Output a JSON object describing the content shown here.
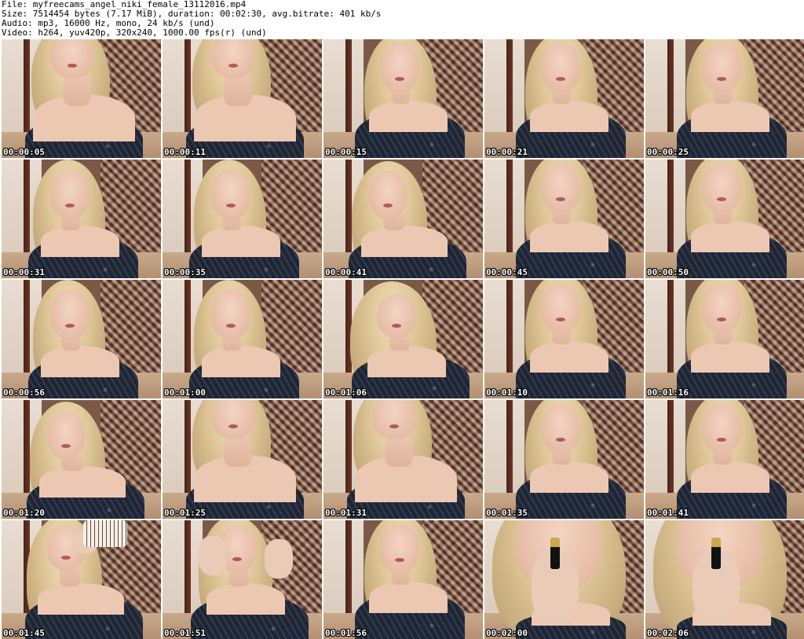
{
  "header": {
    "file_line": "File: myfreecams_angel_niki_female_13112016.mp4",
    "size_line": "Size: 7514454 bytes (7.17 MiB), duration: 00:02:30, avg.bitrate: 401 kb/s",
    "audio_line": "Audio: mp3, 16000 Hz, mono, 24 kb/s (und)",
    "video_line": "Video: h264, yuv420p, 320x240, 1000.00 fps(r) (und)"
  },
  "thumbnails": [
    {
      "timestamp": "00:00:05",
      "pose": "head-tilt-up"
    },
    {
      "timestamp": "00:00:11",
      "pose": "head-tilt-up"
    },
    {
      "timestamp": "00:00:15",
      "pose": "front"
    },
    {
      "timestamp": "00:00:21",
      "pose": "front"
    },
    {
      "timestamp": "00:00:25",
      "pose": "front"
    },
    {
      "timestamp": "00:00:31",
      "pose": "front-left"
    },
    {
      "timestamp": "00:00:35",
      "pose": "front-left"
    },
    {
      "timestamp": "00:00:41",
      "pose": "head-tilt-left"
    },
    {
      "timestamp": "00:00:45",
      "pose": "front"
    },
    {
      "timestamp": "00:00:50",
      "pose": "front"
    },
    {
      "timestamp": "00:00:56",
      "pose": "front-left"
    },
    {
      "timestamp": "00:01:00",
      "pose": "front-left"
    },
    {
      "timestamp": "00:01:06",
      "pose": "head-down"
    },
    {
      "timestamp": "00:01:10",
      "pose": "front"
    },
    {
      "timestamp": "00:01:16",
      "pose": "front"
    },
    {
      "timestamp": "00:01:20",
      "pose": "head-tilt-left"
    },
    {
      "timestamp": "00:01:25",
      "pose": "head-tilt-up"
    },
    {
      "timestamp": "00:01:31",
      "pose": "head-tilt-up"
    },
    {
      "timestamp": "00:01:35",
      "pose": "front"
    },
    {
      "timestamp": "00:01:41",
      "pose": "front"
    },
    {
      "timestamp": "00:01:45",
      "pose": "drinking-cup"
    },
    {
      "timestamp": "00:01:51",
      "pose": "hands-raised"
    },
    {
      "timestamp": "00:01:56",
      "pose": "front"
    },
    {
      "timestamp": "00:02:00",
      "pose": "lipstick-close"
    },
    {
      "timestamp": "00:02:06",
      "pose": "lipstick-close"
    }
  ]
}
